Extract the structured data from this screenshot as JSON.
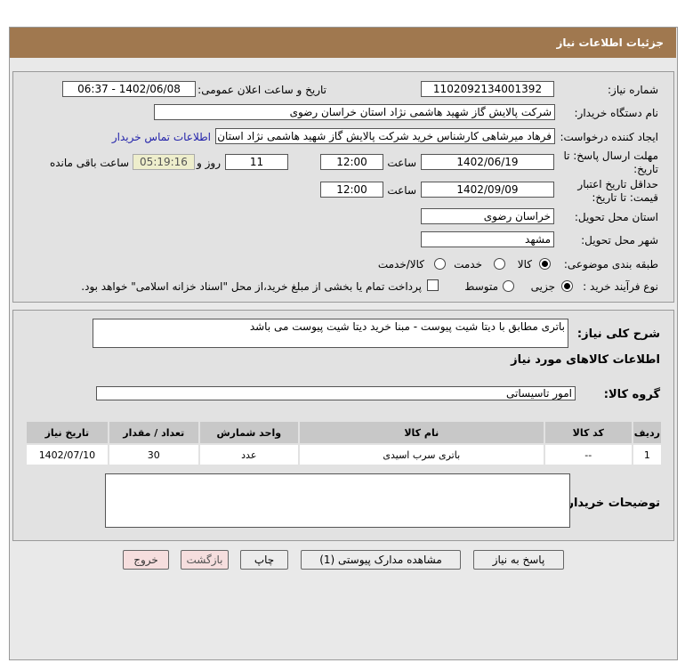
{
  "header": {
    "title": "جزئیات اطلاعات نیاز"
  },
  "form": {
    "need_number_label": "شماره نیاز:",
    "need_number": "1102092134001392",
    "announce_label": "تاریخ و ساعت اعلان عمومی:",
    "announce_value": "1402/06/08 - 06:37",
    "buyer_label": "نام دستگاه خریدار:",
    "buyer_value": "شرکت پالایش گاز شهید هاشمی نژاد   استان خراسان رضوی",
    "creator_label": "ایجاد کننده درخواست:",
    "creator_value": "فرهاد میرشاهی کارشناس خرید شرکت پالایش گاز شهید هاشمی نژاد   استان",
    "contact_link": "اطلاعات تماس خریدار",
    "deadline_label": "مهلت ارسال پاسخ: تا تاریخ:",
    "deadline_date": "1402/06/19",
    "time_label": "ساعت",
    "deadline_time": "12:00",
    "days": "11",
    "days_label": "روز و",
    "remaining": "05:19:16",
    "remaining_label": "ساعت باقی مانده",
    "validity_label": "حداقل تاریخ اعتبار قیمت: تا تاریخ:",
    "validity_date": "1402/09/09",
    "validity_time": "12:00",
    "province_label": "استان محل تحویل:",
    "province": "خراسان رضوی",
    "city_label": "شهر محل تحویل:",
    "city": "مشهد",
    "category_label": "طبقه بندی موضوعی:",
    "category_options": [
      "کالا",
      "خدمت",
      "کالا/خدمت"
    ],
    "category_selected": "کالا",
    "process_label": "نوع فرآیند خرید :",
    "process_options": [
      "جزیی",
      "متوسط"
    ],
    "process_selected": "جزیی",
    "payment_text": "پرداخت تمام یا بخشی از مبلغ خرید،از محل \"اسناد خزانه اسلامی\" خواهد بود."
  },
  "details": {
    "desc_label": "شرح کلی نیاز:",
    "desc": "باتری مطابق با دیتا شیت پیوست - مبنا خرید  دیتا شیت پیوست می باشد",
    "items_title": "اطلاعات کالاهای مورد نیاز",
    "group_label": "گروه کالا:",
    "group": "امور تاسیساتی",
    "columns": [
      "ردیف",
      "کد کالا",
      "نام کالا",
      "واحد شمارش",
      "تعداد / مقدار",
      "تاریخ نیاز"
    ],
    "rows": [
      [
        "1",
        "--",
        "باتری سرب اسیدی",
        "عدد",
        "30",
        "1402/07/10"
      ]
    ],
    "notes_label": "توضیحات خریدار:"
  },
  "buttons": {
    "reply": "پاسخ به نیاز",
    "attachments": "مشاهده مدارک پیوستی (1)",
    "print": "چاپ",
    "back": "بازگشت",
    "exit": "خروج"
  }
}
